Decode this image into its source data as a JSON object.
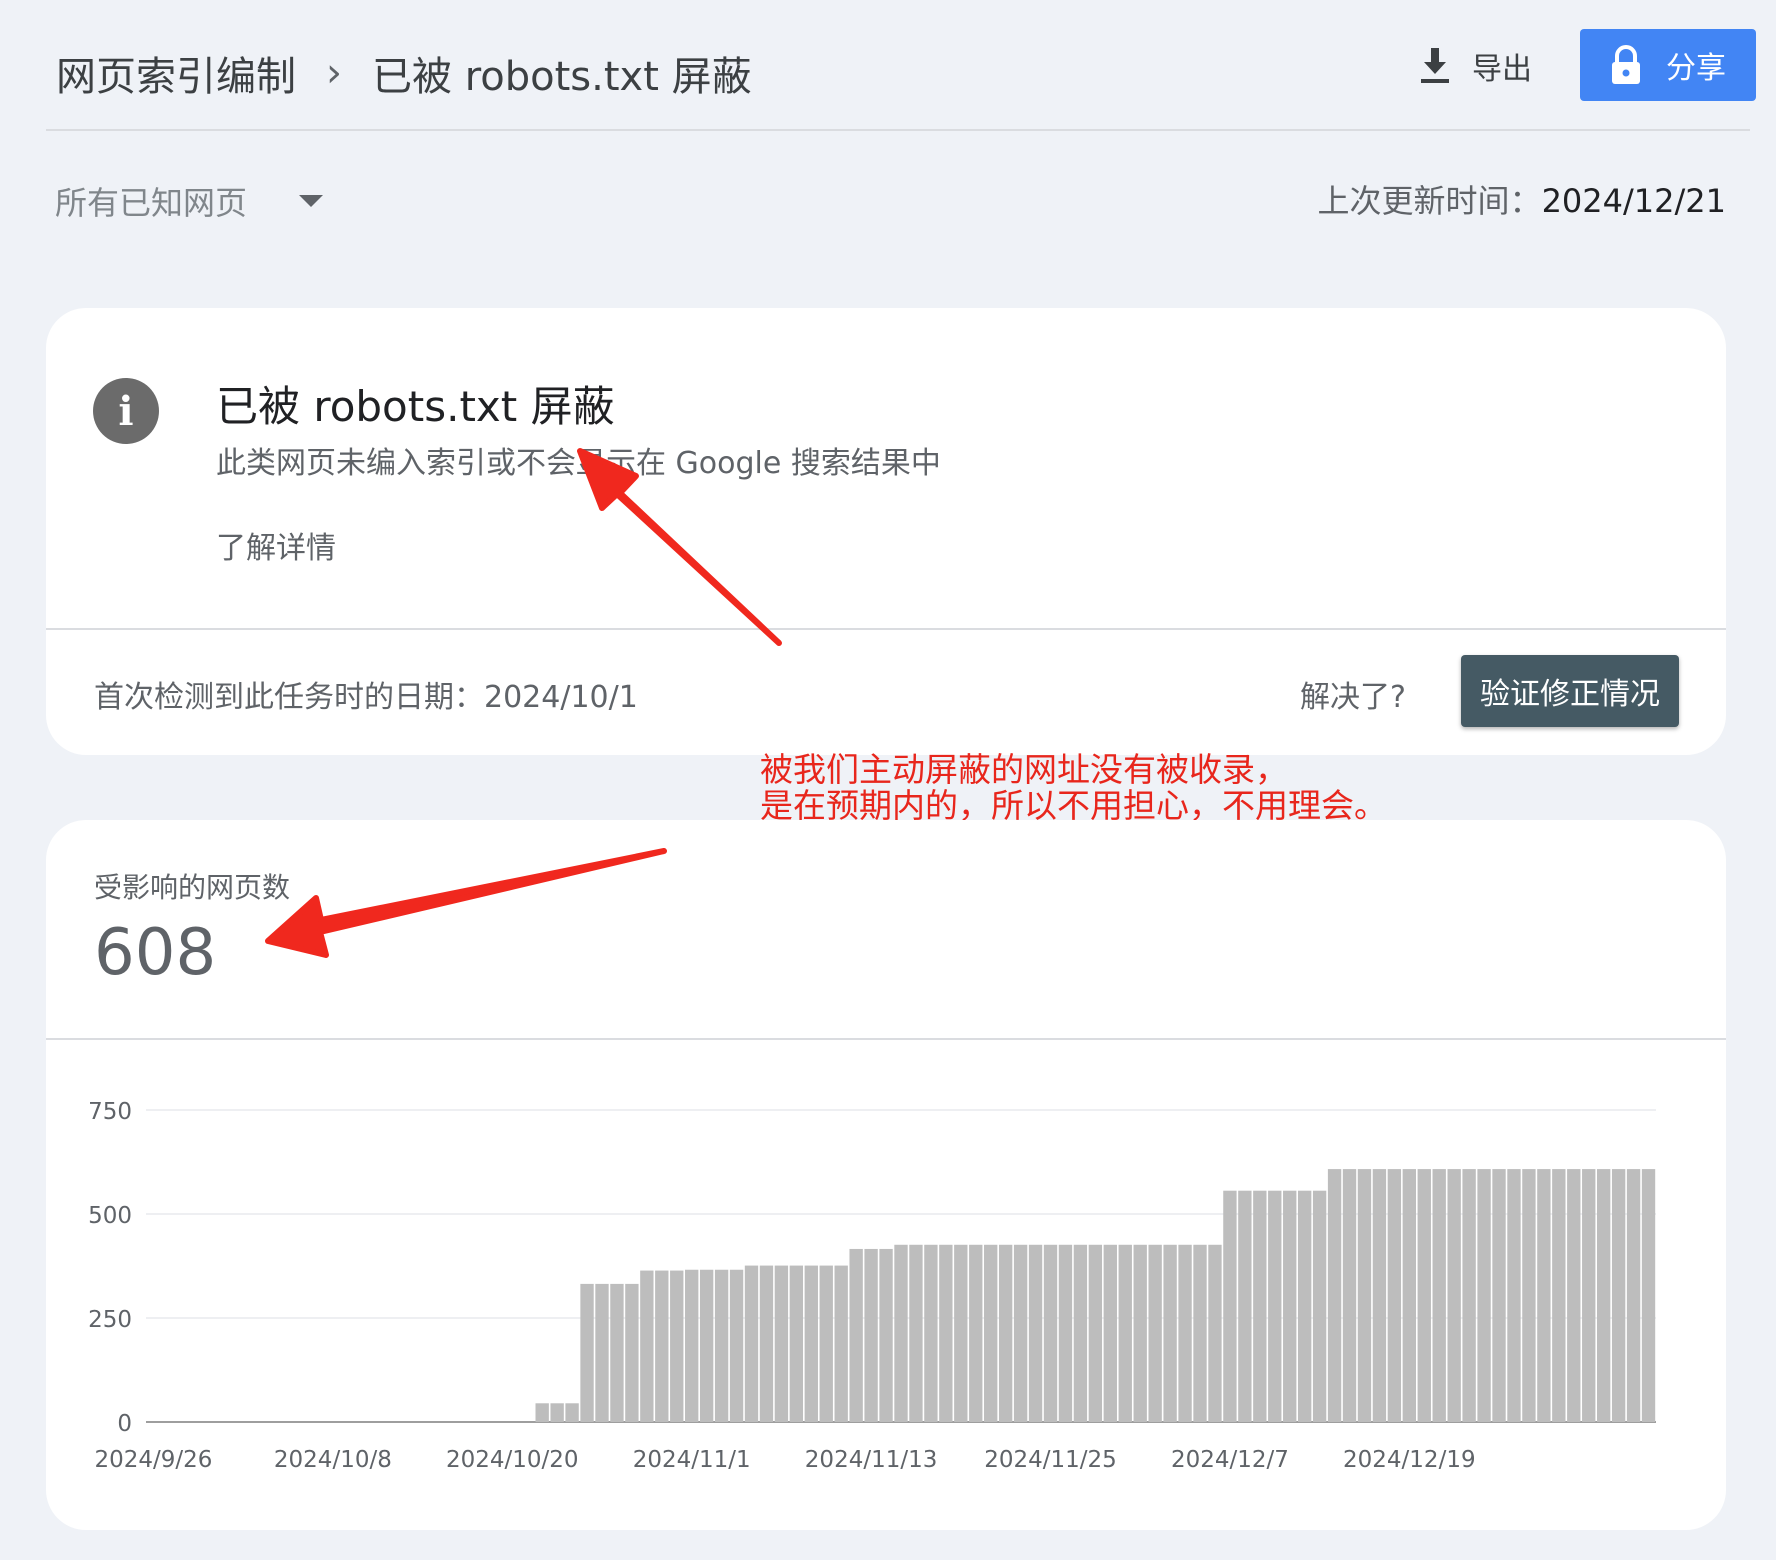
{
  "header": {
    "breadcrumb_root": "网页索引编制",
    "breadcrumb_current": "已被 robots.txt 屏蔽",
    "export_label": "导出",
    "share_label": "分享"
  },
  "filter": {
    "label": "所有已知网页"
  },
  "updated": {
    "label": "上次更新时间：",
    "value": "2024/12/21"
  },
  "issue": {
    "title": "已被 robots.txt 屏蔽",
    "description": "此类网页未编入索引或不会显示在 Google 搜索结果中",
    "learn_more": "了解详情",
    "first_detected": "首次检测到此任务时的日期：2024/10/1",
    "resolved_question": "解决了?",
    "verify_button": "验证修正情况"
  },
  "annotation": {
    "line1": "被我们主动屏蔽的网址没有被收录，",
    "line2": "是在预期内的，所以不用担心，不用理会。",
    "color": "#e8261c"
  },
  "affected": {
    "label": "受影响的网页数",
    "count": "608"
  },
  "chart_data": {
    "type": "bar",
    "ylim": [
      0,
      750
    ],
    "yticks": [
      "0",
      "250",
      "500",
      "750"
    ],
    "x_ticks": [
      {
        "label": "2024/9/26",
        "index": 0
      },
      {
        "label": "2024/10/8",
        "index": 12
      },
      {
        "label": "2024/10/20",
        "index": 24
      },
      {
        "label": "2024/11/1",
        "index": 36
      },
      {
        "label": "2024/11/13",
        "index": 48
      },
      {
        "label": "2024/11/25",
        "index": 60
      },
      {
        "label": "2024/12/7",
        "index": 72
      },
      {
        "label": "2024/12/19",
        "index": 84
      }
    ],
    "values": [
      0,
      0,
      0,
      0,
      0,
      0,
      0,
      0,
      0,
      0,
      0,
      0,
      0,
      0,
      0,
      0,
      0,
      0,
      0,
      0,
      0,
      0,
      0,
      0,
      0,
      0,
      45,
      45,
      45,
      332,
      332,
      332,
      332,
      364,
      364,
      364,
      366,
      366,
      366,
      366,
      376,
      376,
      376,
      376,
      376,
      376,
      376,
      416,
      416,
      416,
      426,
      426,
      426,
      426,
      426,
      426,
      426,
      426,
      426,
      426,
      426,
      426,
      426,
      426,
      426,
      426,
      426,
      426,
      426,
      426,
      426,
      426,
      556,
      556,
      556,
      556,
      556,
      556,
      556,
      608,
      608,
      608,
      608,
      608,
      608,
      608,
      608,
      608,
      608,
      608,
      608,
      608,
      608,
      608,
      608,
      608,
      608,
      608,
      608,
      608,
      608
    ],
    "bar_color": "#bdbdbd",
    "grid": true
  }
}
